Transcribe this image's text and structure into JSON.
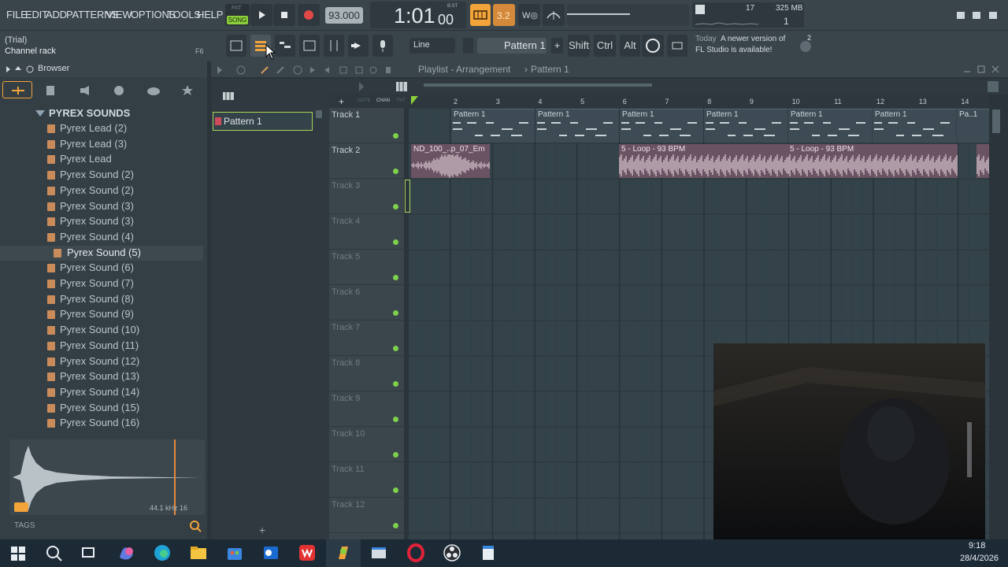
{
  "menu": [
    "FILE",
    "EDIT",
    "ADD",
    "PATTERNS",
    "VIEW",
    "OPTIONS",
    "TOOLS",
    "HELP"
  ],
  "transport": {
    "mode_label": "SONG",
    "mode_alt": "PAT",
    "tempo": "93.000",
    "time": "1:01",
    "time_frac": "00",
    "time_unit": "B:ST"
  },
  "monitor": {
    "cpu": "17",
    "memory": "325 MB",
    "voices": "1"
  },
  "hint": {
    "line1": "(Trial)",
    "line2": "Channel rack",
    "shortcut": "F6"
  },
  "toolbar2": {
    "snap": "Line",
    "pattern": "Pattern 1",
    "keys": [
      "Shift",
      "Ctrl",
      "Alt"
    ],
    "news_date": "Today",
    "news_text1": "A newer version of",
    "news_text2": "FL Studio is available!",
    "news_badge": "2"
  },
  "browser": {
    "title": "Browser",
    "root": "PYREX SOUNDS",
    "items": [
      "Pyrex Lead (2)",
      "Pyrex Lead (3)",
      "Pyrex Lead",
      "Pyrex Sound (2)",
      "Pyrex Sound (2)",
      "Pyrex Sound (3)",
      "Pyrex Sound (3)",
      "Pyrex Sound (4)",
      "Pyrex Sound (5)",
      "Pyrex Sound (6)",
      "Pyrex Sound (7)",
      "Pyrex Sound (8)",
      "Pyrex Sound (9)",
      "Pyrex Sound (10)",
      "Pyrex Sound (11)",
      "Pyrex Sound (12)",
      "Pyrex Sound (13)",
      "Pyrex Sound (14)",
      "Pyrex Sound (15)",
      "Pyrex Sound (16)"
    ],
    "selected_index": 8,
    "sample_info": "44.1 kHz 16",
    "tags_label": "TAGS"
  },
  "picker": {
    "pattern": "Pattern 1"
  },
  "playlist": {
    "title": "Playlist - Arrangement",
    "title_pattern": "Pattern 1",
    "col_labels": [
      "NOTE",
      "CHAN",
      "PAT"
    ],
    "ruler": [
      "2",
      "3",
      "4",
      "5",
      "6",
      "7",
      "8",
      "9",
      "10",
      "11",
      "12",
      "13",
      "14"
    ],
    "tracks": [
      "Track 1",
      "Track 2",
      "Track 3",
      "Track 4",
      "Track 5",
      "Track 6",
      "Track 7",
      "Track 8",
      "Track 9",
      "Track 10",
      "Track 11",
      "Track 12"
    ],
    "pattern_clip": "Pattern 1",
    "pattern_clip_cut": "Pa..1",
    "audio1": "ND_100_..p_07_Em",
    "audio2": "5 - Loop - 93 BPM",
    "audio3": "5 - Loop - 93 BPM"
  },
  "taskbar": {
    "time": "9:18",
    "date": "28/4/2026"
  },
  "colors": {
    "accent_green": "#7ed14a",
    "orange": "#f2a33a",
    "audio_clip": "#6a5363"
  }
}
